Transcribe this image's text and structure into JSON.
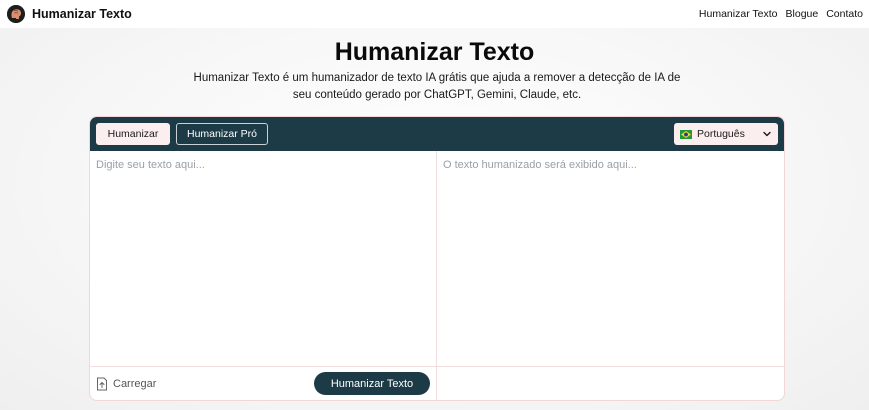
{
  "header": {
    "brand": "Humanizar Texto",
    "logo_icon": "brain-head-icon",
    "nav": [
      "Humanizar Texto",
      "Blogue",
      "Contato"
    ]
  },
  "hero": {
    "title": "Humanizar Texto",
    "subtitle": "Humanizar Texto é um humanizador de texto IA grátis que ajuda a remover a detecção de IA de seu conteúdo gerado por ChatGPT, Gemini, Claude, etc."
  },
  "tool": {
    "tabs": [
      "Humanizar",
      "Humanizar Pró"
    ],
    "active_tab": "Humanizar",
    "language": {
      "label": "Português",
      "flag_icon": "brazil-flag-icon",
      "chevron_icon": "chevron-down-icon"
    },
    "input": {
      "placeholder": "Digite seu texto aqui...",
      "value": ""
    },
    "output": {
      "placeholder": "O texto humanizado será exibido aqui..."
    },
    "upload": {
      "label": "Carregar",
      "icon": "upload-icon"
    },
    "submit_label": "Humanizar Texto"
  },
  "colors": {
    "accent": "#1d3b46",
    "tab_bg": "#fbeeee",
    "border": "#f3d6d6"
  }
}
